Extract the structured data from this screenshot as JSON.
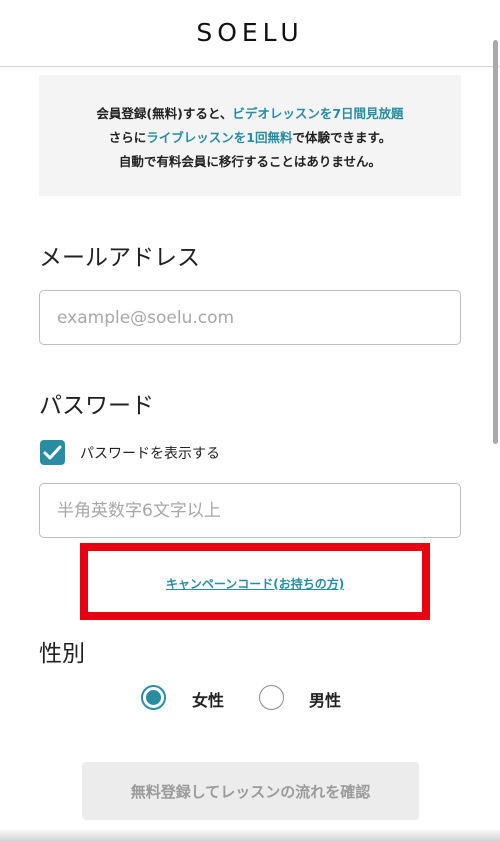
{
  "header": {
    "logo": "SOELU"
  },
  "notice": {
    "line1_a": "会員登録(無料)すると、",
    "line1_b": "ビデオレッスンを7日間見放題",
    "line2_a": "さらに",
    "line2_b": "ライブレッスンを1回無料",
    "line2_c": "で体験できます。",
    "line3": "自動で有料会員に移行することはありません。"
  },
  "email": {
    "label": "メールアドレス",
    "placeholder": "example@soelu.com",
    "value": ""
  },
  "password": {
    "label": "パスワード",
    "show_label": "パスワードを表示する",
    "show_checked": true,
    "placeholder": "半角英数字6文字以上",
    "value": ""
  },
  "campaign": {
    "link_text": "キャンペーンコード(お持ちの方)"
  },
  "gender": {
    "label": "性別",
    "options": [
      {
        "label": "女性",
        "selected": true
      },
      {
        "label": "男性",
        "selected": false
      }
    ]
  },
  "submit": {
    "label": "無料登録してレッスンの流れを確認"
  },
  "colors": {
    "accent": "#2a8ca0",
    "highlight_border": "#e60012",
    "notice_bg": "#f4f4f4",
    "button_bg": "#ececec"
  }
}
